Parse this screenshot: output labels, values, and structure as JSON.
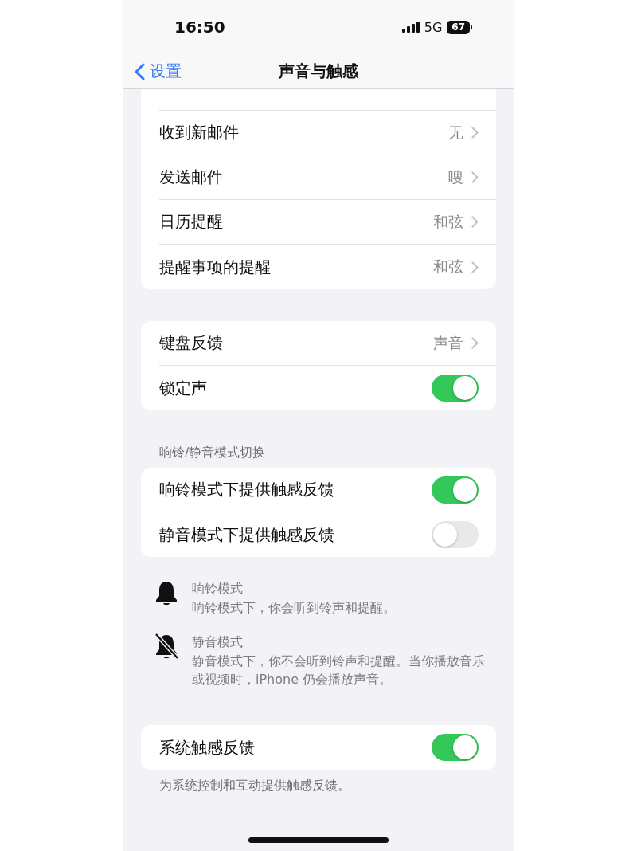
{
  "status_bar": {
    "time": "16:50",
    "network": "5G",
    "battery": "67"
  },
  "nav": {
    "back": "设置",
    "title": "声音与触感"
  },
  "sections": [
    {
      "kind": "card",
      "clipped_top": true,
      "rows": [
        {
          "kind": "link",
          "label": "收到新邮件",
          "value": "无"
        },
        {
          "kind": "link",
          "label": "发送邮件",
          "value": "嗖"
        },
        {
          "kind": "link",
          "label": "日历提醒",
          "value": "和弦"
        },
        {
          "kind": "link",
          "label": "提醒事项的提醒",
          "value": "和弦"
        }
      ]
    },
    {
      "kind": "card",
      "rows": [
        {
          "kind": "link",
          "label": "键盘反馈",
          "value": "声音"
        },
        {
          "kind": "toggle",
          "label": "锁定声",
          "on": true
        }
      ]
    },
    {
      "kind": "card",
      "header": "响铃/静音模式切换",
      "rows": [
        {
          "kind": "toggle",
          "label": "响铃模式下提供触感反馈",
          "on": true
        },
        {
          "kind": "toggle",
          "label": "静音模式下提供触感反馈",
          "on": false
        }
      ]
    },
    {
      "kind": "info",
      "items": [
        {
          "kind": "ring",
          "title": "响铃模式",
          "text": "响铃模式下，你会听到铃声和提醒。"
        },
        {
          "kind": "silent",
          "title": "静音模式",
          "text": "静音模式下，你不会听到铃声和提醒。当你播放音乐或视频时，iPhone 仍会播放声音。"
        }
      ]
    },
    {
      "kind": "card",
      "rows": [
        {
          "kind": "toggle",
          "label": "系统触感反馈",
          "on": true
        }
      ],
      "footer": "为系统控制和互动提供触感反馈。"
    }
  ]
}
